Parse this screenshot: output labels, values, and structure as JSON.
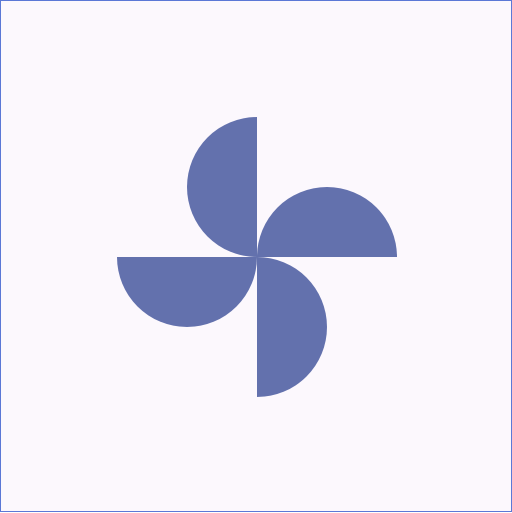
{
  "logo": {
    "icon": "pinwheel-icon",
    "color": "#6371ad"
  },
  "canvas": {
    "background": "#fcf8fd",
    "border_color": "#5b78d6"
  }
}
